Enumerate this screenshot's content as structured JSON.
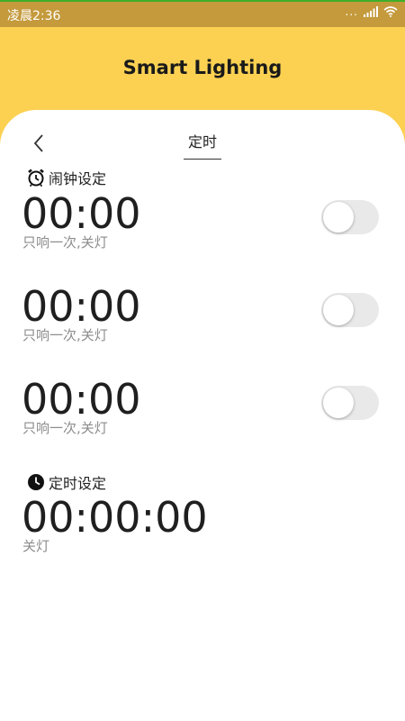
{
  "status_bar": {
    "time": "凌晨2:36",
    "dots": "...",
    "signal_icon": "signal-icon",
    "wifi_icon": "wifi-icon"
  },
  "header": {
    "title": "Smart Lighting"
  },
  "nav": {
    "back_icon": "chevron-left-icon",
    "tab_title": "定时"
  },
  "alarm_section": {
    "label": "闹钟设定",
    "icon": "alarm-clock-icon",
    "alarms": [
      {
        "time": "00:00",
        "desc": "只响一次,关灯",
        "enabled": false
      },
      {
        "time": "00:00",
        "desc": "只响一次,关灯",
        "enabled": false
      },
      {
        "time": "00:00",
        "desc": "只响一次,关灯",
        "enabled": false
      }
    ]
  },
  "timer_section": {
    "label": "定时设定",
    "icon": "clock-icon",
    "time": "00:00:00",
    "desc": "关灯"
  },
  "colors": {
    "header_bg": "#fcd152",
    "status_bg": "#c49a3c",
    "toggle_off": "#e9e9e9"
  }
}
